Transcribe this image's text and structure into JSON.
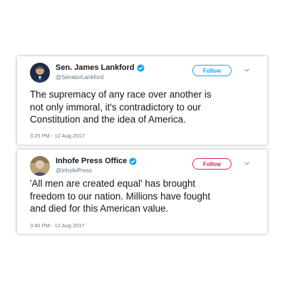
{
  "tweets": [
    {
      "name": "Sen. James Lankford",
      "handle": "@SenatorLankford",
      "follow_label": "Follow",
      "text": "The supremacy of any race over another is\nnot only immoral, it's contradictory to our\nConstitution and the idea of America.",
      "timestamp": "3:25 PM - 12 Aug 2017",
      "follow_color": "#1da1f2"
    },
    {
      "name": "Inhofe Press Office",
      "handle": "@InhofePress",
      "follow_label": "Follow",
      "text": "'All men are created equal' has brought\nfreedom to our nation. Millions have fought\nand died for this American value.",
      "timestamp": "3:40 PM - 12 Aug 2017",
      "follow_color": "#e0245e"
    }
  ],
  "colors": {
    "verified": "#1da1f2",
    "text": "#14171a",
    "muted": "#657786"
  }
}
